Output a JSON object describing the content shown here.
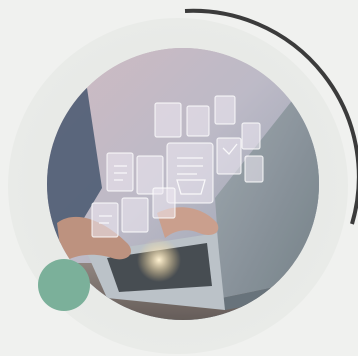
{
  "colors": {
    "background": "#f0f1ef",
    "ring_arc": "#3b3b3b",
    "accent_dot": "#7bb09a",
    "photo_tint": "#c7b7bd"
  },
  "illustration": {
    "subject": "hands-on-laptop-with-floating-document-icons",
    "icons": [
      "document-icon",
      "file-icon",
      "folder-icon",
      "checklist-icon"
    ]
  }
}
